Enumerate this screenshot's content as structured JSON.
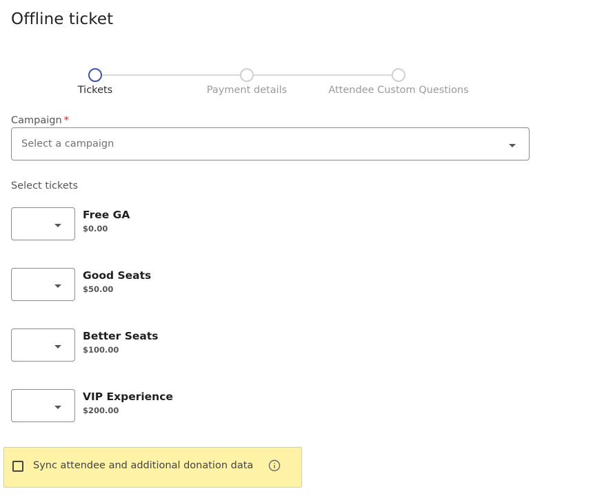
{
  "page": {
    "title": "Offline ticket"
  },
  "stepper": {
    "steps": [
      {
        "label": "Tickets",
        "active": true
      },
      {
        "label": "Payment details",
        "active": false
      },
      {
        "label": "Attendee Custom Questions",
        "active": false
      }
    ]
  },
  "campaign": {
    "label": "Campaign",
    "required_mark": "*",
    "placeholder": "Select a campaign"
  },
  "tickets": {
    "section_label": "Select tickets",
    "items": [
      {
        "name": "Free GA",
        "price": "$0.00"
      },
      {
        "name": "Good Seats",
        "price": "$50.00"
      },
      {
        "name": "Better Seats",
        "price": "$100.00"
      },
      {
        "name": "VIP Experience",
        "price": "$200.00"
      }
    ]
  },
  "sync": {
    "label": "Sync attendee and additional donation data",
    "checked": false,
    "info_icon": "info-circle-icon"
  },
  "colors": {
    "accent": "#3f51b5",
    "required": "#c62828",
    "highlight_bg": "#fdf2a6"
  }
}
